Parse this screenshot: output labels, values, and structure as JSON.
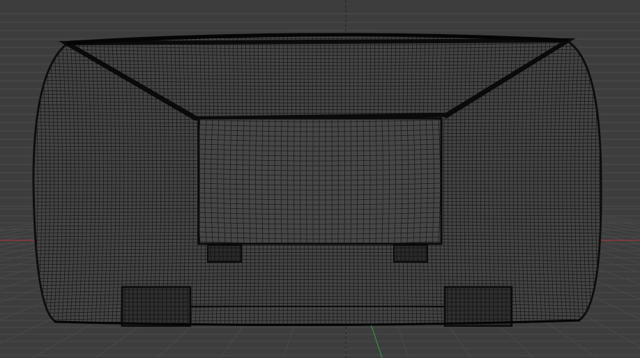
{
  "viewport": {
    "background": "#3d3d3d",
    "grid_color": "#4d4d4d",
    "wire_color": "#111111",
    "x_axis_color": "#9c3a3a",
    "y_axis_color": "#2f9a3a",
    "center_line_color": "#222222",
    "mesh": "wireframe-box",
    "view": "front-orthographic"
  }
}
